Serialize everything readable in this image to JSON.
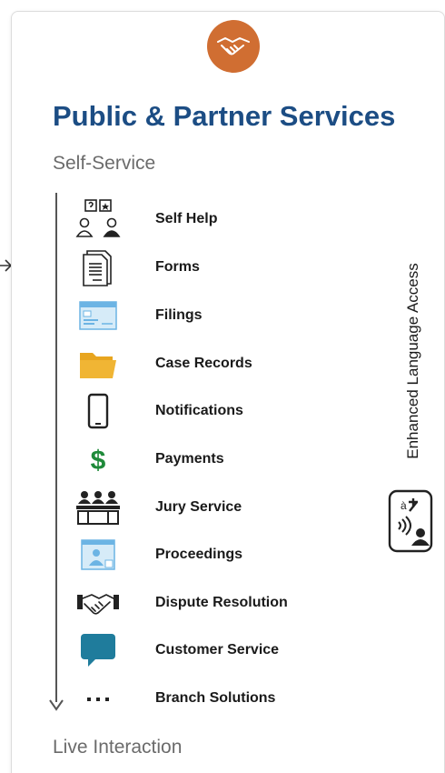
{
  "header": {
    "badge_icon": "handshake-icon",
    "title": "Public & Partner Services",
    "subtitle": "Self-Service"
  },
  "services": [
    {
      "label": "Self Help",
      "icon": "self-help-icon"
    },
    {
      "label": "Forms",
      "icon": "forms-icon"
    },
    {
      "label": "Filings",
      "icon": "filings-icon"
    },
    {
      "label": "Case Records",
      "icon": "folder-icon"
    },
    {
      "label": "Notifications",
      "icon": "mobile-phone-icon"
    },
    {
      "label": "Payments",
      "icon": "dollar-icon"
    },
    {
      "label": "Jury Service",
      "icon": "jury-icon"
    },
    {
      "label": "Proceedings",
      "icon": "video-proceedings-icon"
    },
    {
      "label": "Dispute Resolution",
      "icon": "handshake-icon"
    },
    {
      "label": "Customer Service",
      "icon": "chat-bubble-icon"
    },
    {
      "label": "Branch Solutions",
      "icon": "ellipsis-icon"
    }
  ],
  "side": {
    "label": "Enhanced Language Access",
    "icon": "language-access-icon"
  },
  "footer": {
    "label": "Live Interaction"
  },
  "colors": {
    "title": "#1c4d84",
    "badge": "#d06e32",
    "folder": "#e8a51f",
    "dollar": "#1f8a3a",
    "chat": "#1f7c9c",
    "light_blue": "#6cb4e4"
  }
}
